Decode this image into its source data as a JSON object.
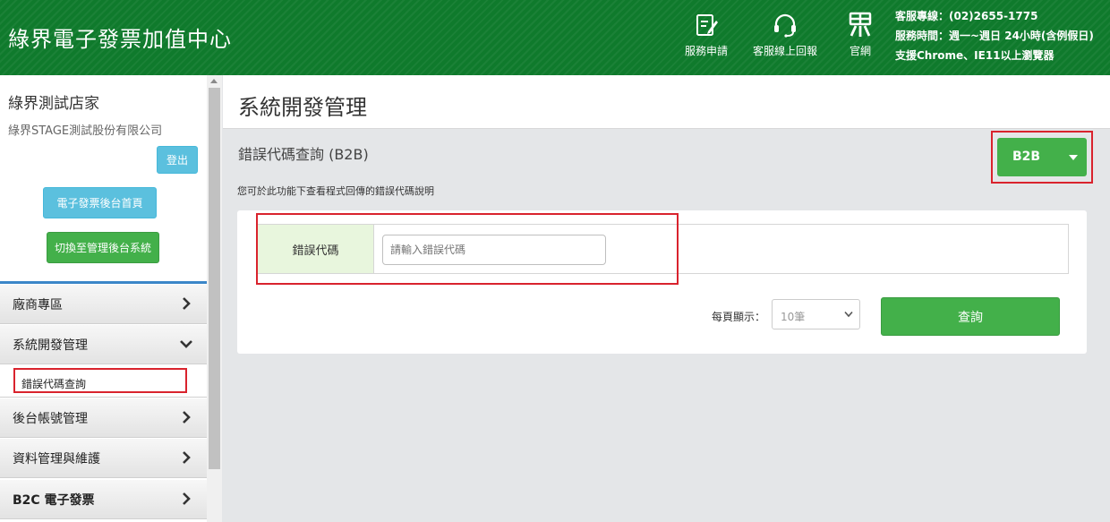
{
  "header": {
    "brand": "綠界電子發票加值中心",
    "nav": [
      {
        "label": "服務申請",
        "icon": "edit-document-icon"
      },
      {
        "label": "客服線上回報",
        "icon": "headset-icon"
      },
      {
        "label": "官網",
        "icon": "ecpay-logo-icon"
      }
    ],
    "info": [
      "客服專線：(02)2655-1775",
      "服務時間：週一~週日 24小時(含例假日)",
      "支援Chrome、IE11以上瀏覽器"
    ]
  },
  "sidebar": {
    "shop_name": "綠界測試店家",
    "company": "綠界STAGE測試股份有限公司",
    "logout_label": "登出",
    "home_label": "電子發票後台首頁",
    "switch_label": "切換至管理後台系統",
    "menu": [
      {
        "label": "廠商專區",
        "state": "collapsed"
      },
      {
        "label": "系統開發管理",
        "state": "expanded"
      },
      {
        "label": "後台帳號管理",
        "state": "collapsed"
      },
      {
        "label": "資料管理與維護",
        "state": "collapsed"
      },
      {
        "label": "B2C 電子發票",
        "state": "collapsed"
      }
    ],
    "submenu": [
      {
        "label": "錯誤代碼查詢"
      }
    ]
  },
  "main": {
    "page_title": "系統開發管理",
    "section_title": "錯誤代碼查詢 (B2B)",
    "description": "您可於此功能下查看程式回傳的錯誤代碼說明",
    "mode_selector": {
      "label": "B2B"
    },
    "form": {
      "field_label": "錯誤代碼",
      "field_placeholder": "請輸入錯誤代碼",
      "field_value": ""
    },
    "pagination": {
      "label": "每頁顯示：",
      "selected": "10筆"
    },
    "query_label": "查詢"
  },
  "colors": {
    "header_bg": "#0f7a2c",
    "primary_green": "#43b04a",
    "info_blue": "#5bc0de",
    "highlight_red": "#d9232d"
  }
}
